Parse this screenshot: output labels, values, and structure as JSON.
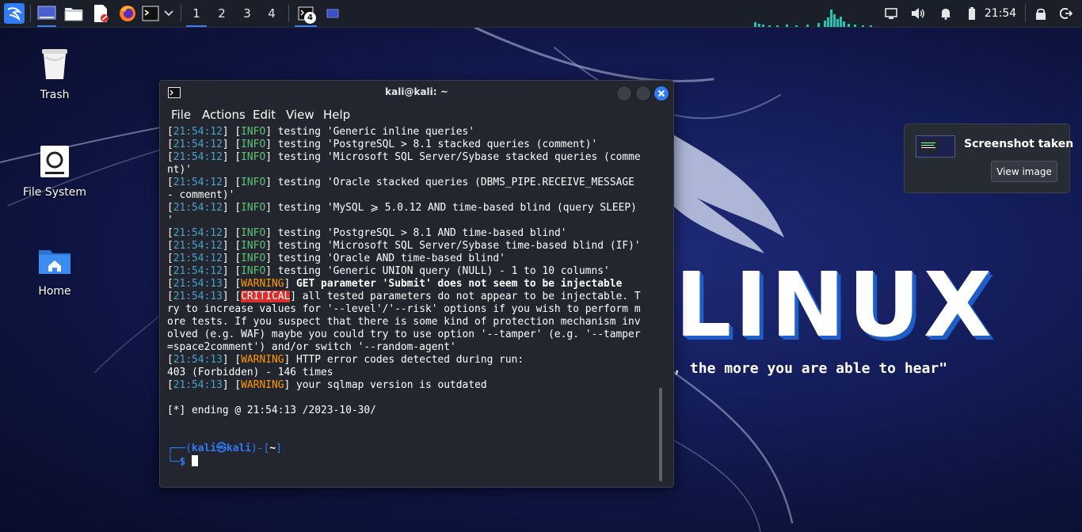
{
  "panel": {
    "workspaces": [
      "1",
      "2",
      "3",
      "4"
    ],
    "active_workspace": "1",
    "terminal_task_badge": "4",
    "clock": "21:54"
  },
  "desktop": {
    "icons": [
      {
        "label": "Trash",
        "icon": "trash-icon"
      },
      {
        "label": "File System",
        "icon": "drive-icon"
      },
      {
        "label": "Home",
        "icon": "home-folder-icon"
      }
    ]
  },
  "wallpaper": {
    "logo_text": "LINUX",
    "quote": "\"the quieter you become, the more you are able to hear\""
  },
  "terminal": {
    "title": "kali@kali: ~",
    "menu": [
      "File",
      "Actions",
      "Edit",
      "View",
      "Help"
    ],
    "lines": [
      {
        "ts": "21:54:12",
        "level": "INFO",
        "msg": "testing 'Generic inline queries'"
      },
      {
        "ts": "21:54:12",
        "level": "INFO",
        "msg": "testing 'PostgreSQL > 8.1 stacked queries (comment)'"
      },
      {
        "ts": "21:54:12",
        "level": "INFO",
        "msg": "testing 'Microsoft SQL Server/Sybase stacked queries (comme"
      },
      {
        "cont": "nt)'"
      },
      {
        "ts": "21:54:12",
        "level": "INFO",
        "msg": "testing 'Oracle stacked queries (DBMS_PIPE.RECEIVE_MESSAGE"
      },
      {
        "cont": "- comment)'"
      },
      {
        "ts": "21:54:12",
        "level": "INFO",
        "msg": "testing 'MySQL ⩾ 5.0.12 AND time-based blind (query SLEEP)"
      },
      {
        "cont": "'"
      },
      {
        "ts": "21:54:12",
        "level": "INFO",
        "msg": "testing 'PostgreSQL > 8.1 AND time-based blind'"
      },
      {
        "ts": "21:54:12",
        "level": "INFO",
        "msg": "testing 'Microsoft SQL Server/Sybase time-based blind (IF)'"
      },
      {
        "ts": "21:54:12",
        "level": "INFO",
        "msg": "testing 'Oracle AND time-based blind'"
      },
      {
        "ts": "21:54:12",
        "level": "INFO",
        "msg": "testing 'Generic UNION query (NULL) - 1 to 10 columns'"
      },
      {
        "ts": "21:54:13",
        "level": "WARNING",
        "msg": "GET parameter 'Submit' does not seem to be injectable",
        "bold": true
      },
      {
        "ts": "21:54:13",
        "level": "CRITICAL",
        "msg": "all tested parameters do not appear to be injectable. T"
      },
      {
        "cont": "ry to increase values for '--level'/'--risk' options if you wish to perform m"
      },
      {
        "cont": "ore tests. If you suspect that there is some kind of protection mechanism inv"
      },
      {
        "cont": "olved (e.g. WAF) maybe you could try to use option '--tamper' (e.g. '--tamper"
      },
      {
        "cont": "=space2comment') and/or switch '--random-agent'"
      },
      {
        "ts": "21:54:13",
        "level": "WARNING",
        "msg": "HTTP error codes detected during run:"
      },
      {
        "cont": "403 (Forbidden) - 146 times"
      },
      {
        "ts": "21:54:13",
        "level": "WARNING",
        "msg": "your sqlmap version is outdated"
      },
      {
        "cont": ""
      },
      {
        "cont": "[*] ending @ 21:54:13 /2023-10-30/"
      },
      {
        "cont": ""
      },
      {
        "cont": ""
      }
    ],
    "prompt": {
      "user": "kali",
      "host": "kali",
      "path": "~",
      "symbol": "$"
    }
  },
  "notification": {
    "title": "Screenshot taken",
    "button": "View image"
  },
  "colors": {
    "info": "#5ec476",
    "warning": "#ff9b00",
    "critical_bg": "#d9302c",
    "timestamp": "#4aa3c8",
    "prompt": "#2f7cf6",
    "close_button": "#2f7cf6"
  }
}
